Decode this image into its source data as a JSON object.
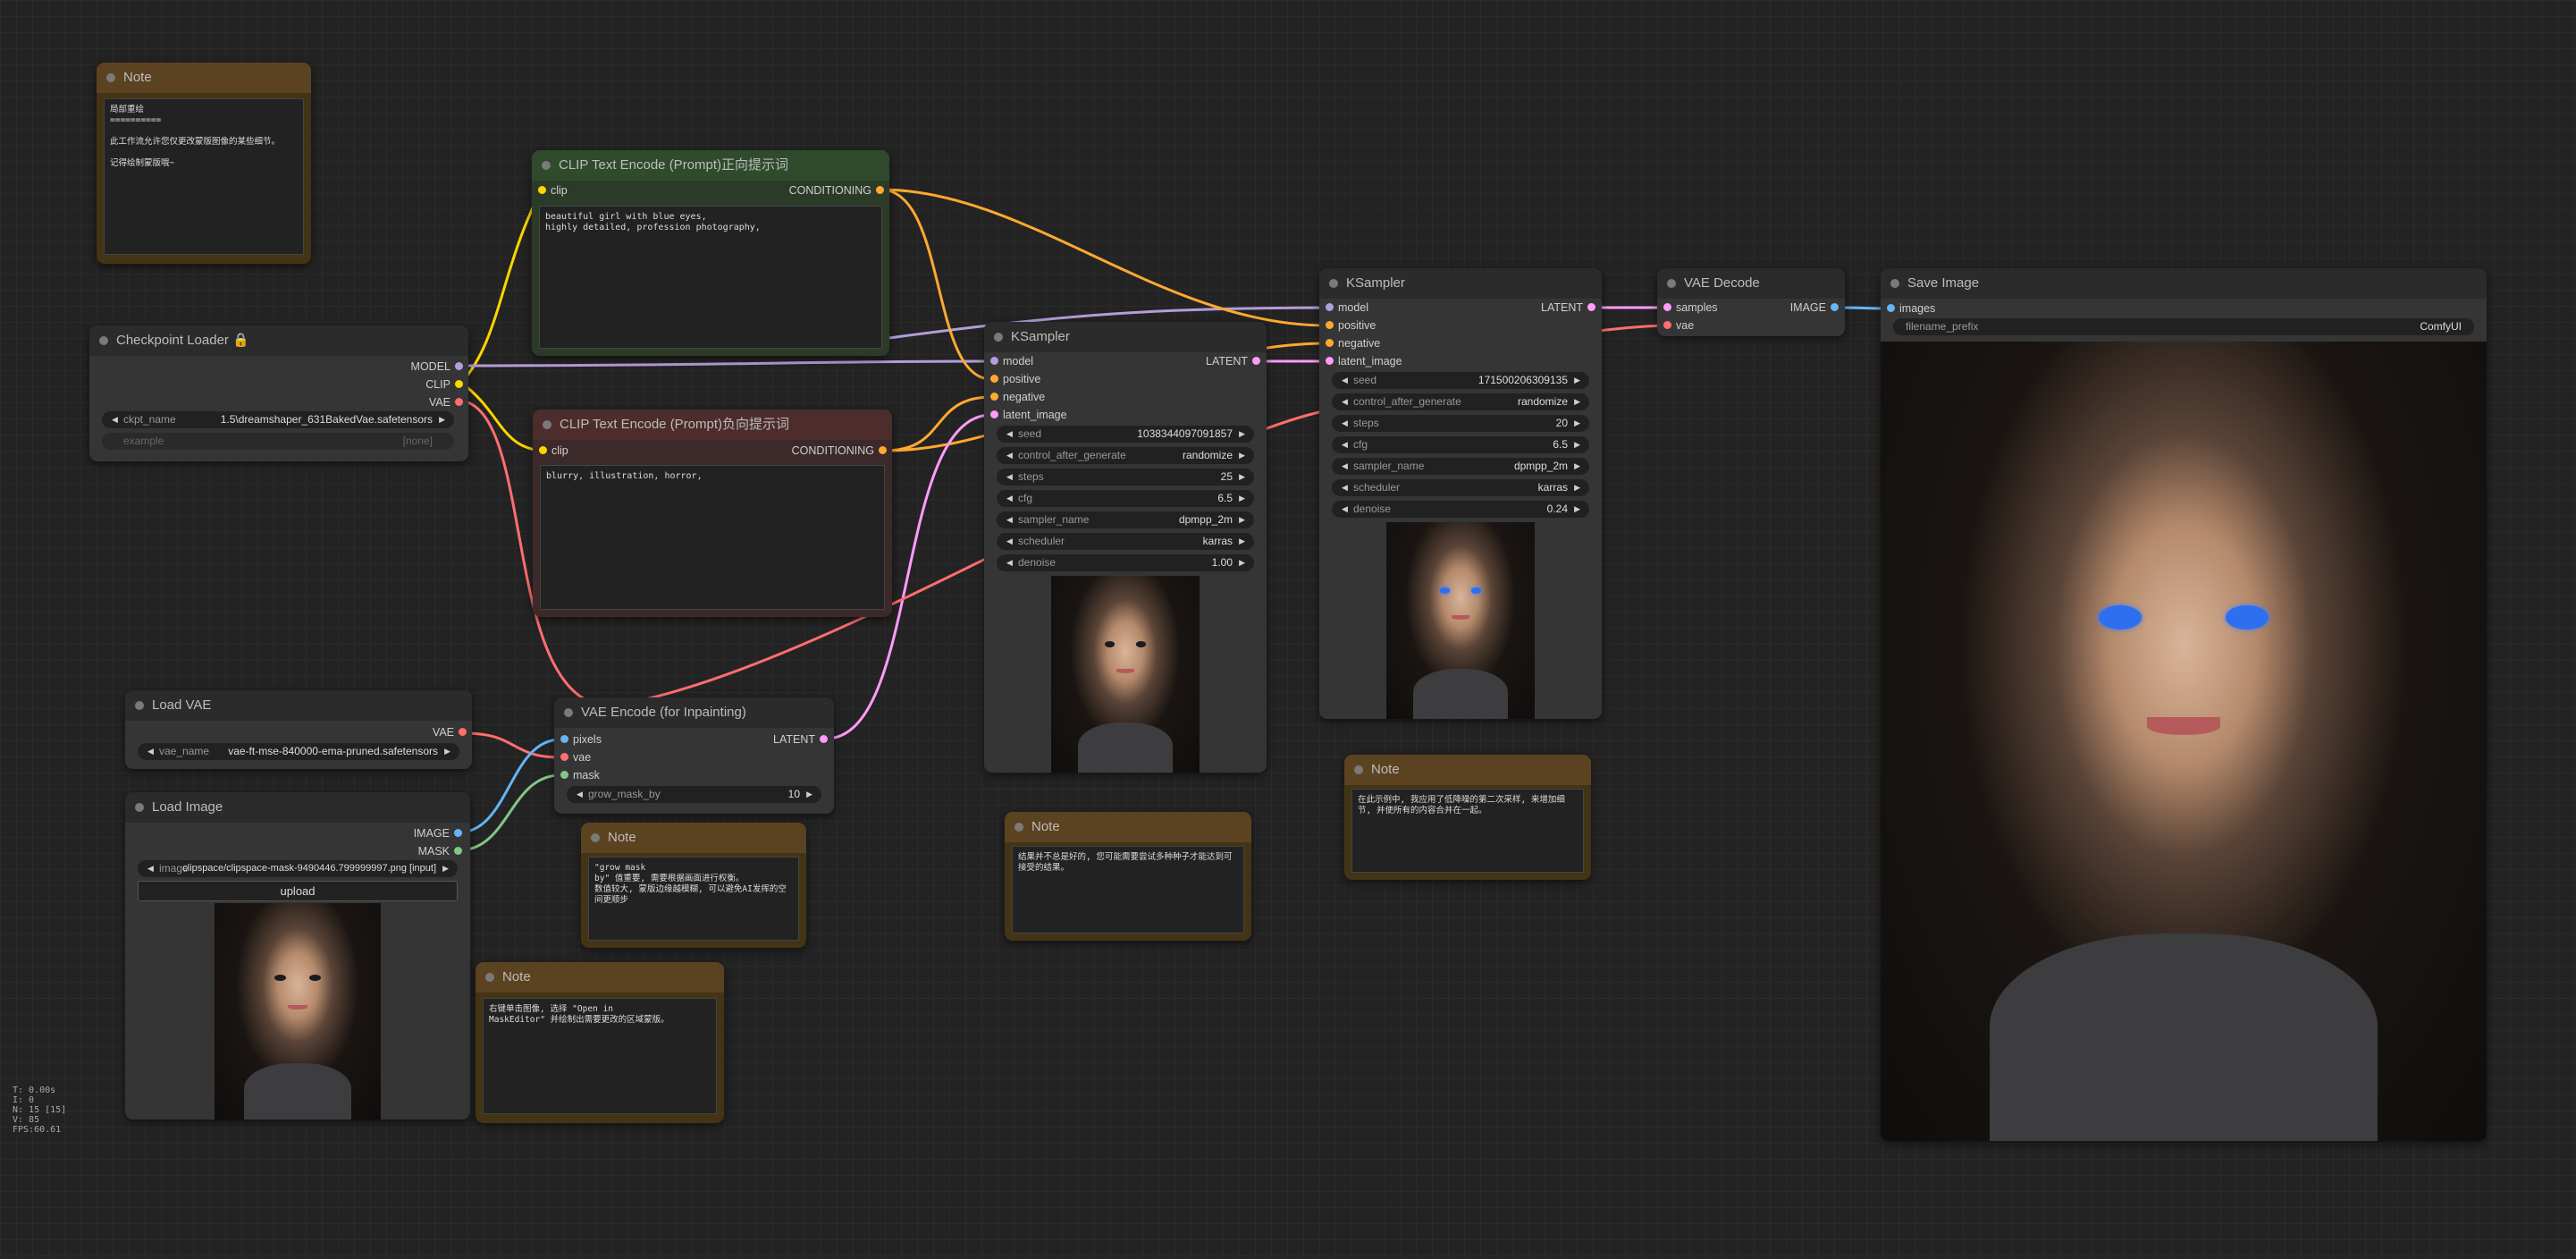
{
  "colors": {
    "background": "#232323",
    "link_model": "#b39ddb",
    "link_clip": "#ffd500",
    "link_vae": "#ff6e6e",
    "link_conditioning": "#ffa931",
    "link_latent": "#ff9cf9",
    "link_image": "#64b5f6",
    "link_mask": "#81c784",
    "note_body": "#433415",
    "clip_positive_header": "#2f4b2c",
    "clip_negative_header": "#4d2c2c"
  },
  "nodes": {
    "note_top": {
      "title": "Note",
      "text": "局部重绘\n==========\n\n此工作流允许您仅更改蒙版图像的某些细节。\n\n记得绘制蒙版哦~"
    },
    "checkpoint_loader": {
      "title": "Checkpoint Loader",
      "outputs": [
        "MODEL",
        "CLIP",
        "VAE"
      ],
      "ckpt_label": "ckpt_name",
      "ckpt_value": "1.5\\dreamshaper_631BakedVae.safetensors",
      "example_label": "example",
      "example_value": "[none]"
    },
    "clip_positive": {
      "title": "CLIP Text Encode (Prompt)正向提示词",
      "input": "clip",
      "output": "CONDITIONING",
      "text": "beautiful girl with blue eyes,\nhighly detailed, profession photography,"
    },
    "clip_negative": {
      "title": "CLIP Text Encode (Prompt)负向提示词",
      "input": "clip",
      "output": "CONDITIONING",
      "text": "blurry, illustration, horror,"
    },
    "ksampler1": {
      "title": "KSampler",
      "inputs": [
        "model",
        "positive",
        "negative",
        "latent_image"
      ],
      "output": "LATENT",
      "widgets": [
        {
          "name": "seed",
          "value": "1038344097091857"
        },
        {
          "name": "control_after_generate",
          "value": "randomize"
        },
        {
          "name": "steps",
          "value": "25"
        },
        {
          "name": "cfg",
          "value": "6.5"
        },
        {
          "name": "sampler_name",
          "value": "dpmpp_2m"
        },
        {
          "name": "scheduler",
          "value": "karras"
        },
        {
          "name": "denoise",
          "value": "1.00"
        }
      ]
    },
    "ksampler2": {
      "title": "KSampler",
      "inputs": [
        "model",
        "positive",
        "negative",
        "latent_image"
      ],
      "output": "LATENT",
      "widgets": [
        {
          "name": "seed",
          "value": "171500206309135"
        },
        {
          "name": "control_after_generate",
          "value": "randomize"
        },
        {
          "name": "steps",
          "value": "20"
        },
        {
          "name": "cfg",
          "value": "6.5"
        },
        {
          "name": "sampler_name",
          "value": "dpmpp_2m"
        },
        {
          "name": "scheduler",
          "value": "karras"
        },
        {
          "name": "denoise",
          "value": "0.24"
        }
      ]
    },
    "vae_decode": {
      "title": "VAE Decode",
      "inputs": [
        "samples",
        "vae"
      ],
      "output": "IMAGE"
    },
    "save_image": {
      "title": "Save Image",
      "input": "images",
      "prefix_label": "filename_prefix",
      "prefix_value": "ComfyUI"
    },
    "load_vae": {
      "title": "Load VAE",
      "output": "VAE",
      "vae_label": "vae_name",
      "vae_value": "vae-ft-mse-840000-ema-pruned.safetensors"
    },
    "vae_encode": {
      "title": "VAE Encode (for Inpainting)",
      "inputs": [
        "pixels",
        "vae",
        "mask"
      ],
      "output": "LATENT",
      "grow_label": "grow_mask_by",
      "grow_value": "10"
    },
    "load_image": {
      "title": "Load Image",
      "outputs": [
        "IMAGE",
        "MASK"
      ],
      "image_label": "image",
      "image_value": "clipspace/clipspace-mask-9490446.799999997.png [input]",
      "upload_label": "upload"
    },
    "note_grow": {
      "title": "Note",
      "text": "\"grow mask\nby\" 值重要, 需要根据画面进行权衡。\n数值较大, 蒙版边缘越模糊, 可以避免AI发挥的空间更顺步"
    },
    "note_open": {
      "title": "Note",
      "text": "右键单击图像, 选择 \"Open in\nMaskEditor\" 并绘制出需要更改的区域蒙版。"
    },
    "note_mid": {
      "title": "Note",
      "text": "结果并不总是好的, 您可能需要尝试多种种子才能达到可接受的结果。"
    },
    "note_right": {
      "title": "Note",
      "text": "在此示例中, 我应用了低降噪的第二次采样, 来增加细节, 并使所有的内容合并在一起。"
    }
  },
  "stats": [
    "T: 0.00s",
    "I: 0",
    "N: 15 [15]",
    "V: 85",
    "FPS:60.61"
  ]
}
